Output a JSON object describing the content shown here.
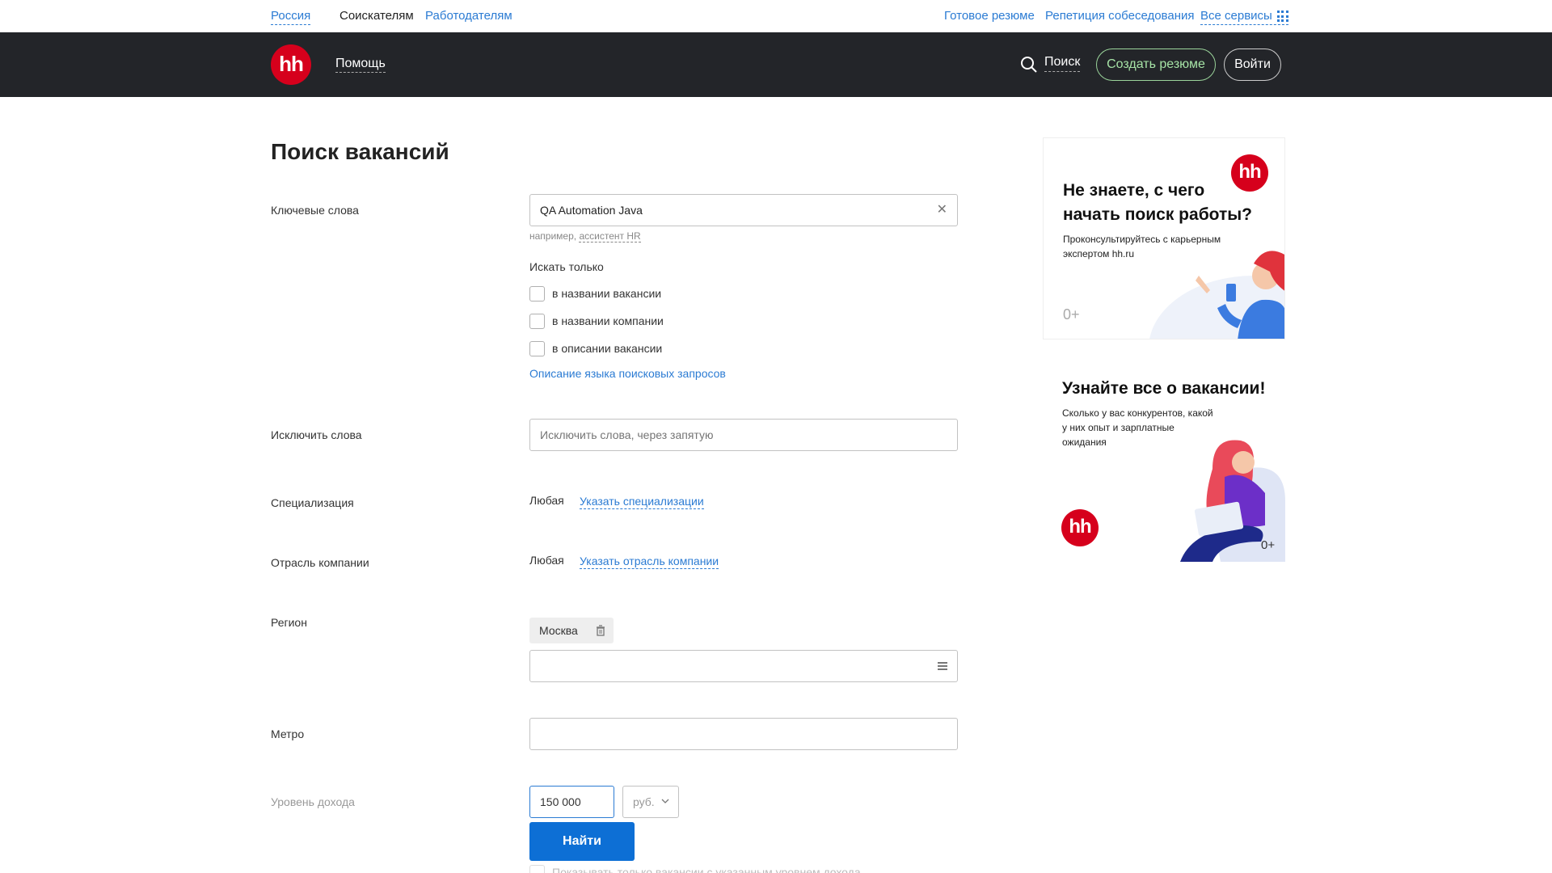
{
  "topbar": {
    "region": "Россия",
    "seekers": "Соискателям",
    "employers": "Работодателям",
    "ready_resume": "Готовое резюме",
    "interview_rehearsal": "Репетиция собеседования",
    "all_services": "Все сервисы"
  },
  "header": {
    "logo": "hh",
    "help": "Помощь",
    "search": "Поиск",
    "create_resume": "Создать резюме",
    "login": "Войти"
  },
  "form": {
    "title": "Поиск вакансий",
    "keywords_label": "Ключевые слова",
    "keywords_value": "QA Automation Java",
    "hint_prefix": "например, ",
    "hint_example": "ассистент HR",
    "search_only_label": "Искать только",
    "checkboxes": [
      {
        "label": "в названии вакансии",
        "checked": false
      },
      {
        "label": "в названии компании",
        "checked": false
      },
      {
        "label": "в описании вакансии",
        "checked": false
      }
    ],
    "query_language_link": "Описание языка поисковых запросов",
    "exclude_label": "Исключить слова",
    "exclude_placeholder": "Исключить слова, через запятую",
    "specialization_label": "Специализация",
    "specialization_value": "Любая",
    "specialization_link": "Указать специализации",
    "industry_label": "Отрасль компании",
    "industry_value": "Любая",
    "industry_link": "Указать отрасль компании",
    "region_label": "Регион",
    "region_chip": "Москва",
    "metro_label": "Метро",
    "salary_label": "Уровень дохода",
    "salary_value": "150 000",
    "currency": "руб.",
    "find_button": "Найти",
    "salary_only_label": "Показывать только вакансии с указанным уровнем дохода"
  },
  "banners": [
    {
      "title_line1": "Не знаете, с чего",
      "title_line2": "начать поиск работы?",
      "text_line1": "Проконсультируйтесь с карьерным",
      "text_line2": "экспертом hh.ru",
      "age": "0+",
      "logo": "hh"
    },
    {
      "title": "Узнайте все о вакансии!",
      "text_line1": "Сколько у вас конкурентов, какой",
      "text_line2": "у них опыт и зарплатные",
      "text_line3": "ожидания",
      "age": "0+",
      "logo": "hh"
    }
  ],
  "colors": {
    "brand_red": "#d6001c",
    "link_blue": "#2b7bd3",
    "header_dark": "#232529",
    "primary_button": "#0d6fd5",
    "create_resume_green": "#a6e3a6"
  },
  "icons": [
    "grid-icon",
    "search-icon",
    "clear-icon",
    "trash-icon",
    "list-icon",
    "chevron-down-icon"
  ]
}
